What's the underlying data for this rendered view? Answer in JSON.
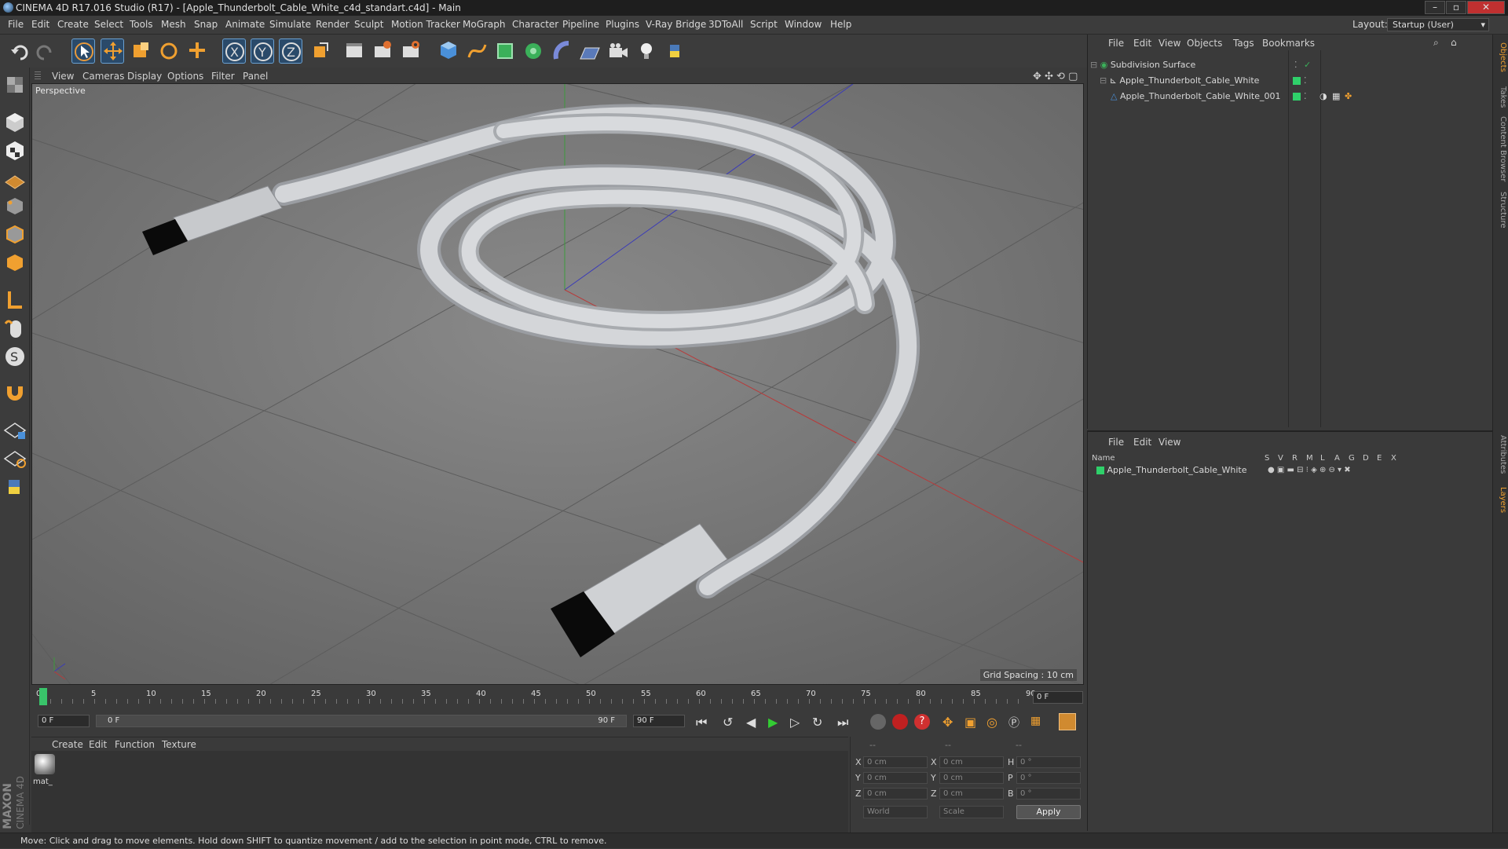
{
  "window": {
    "title": "CINEMA 4D R17.016 Studio (R17) - [Apple_Thunderbolt_Cable_White_c4d_standart.c4d] - Main"
  },
  "menu": [
    "File",
    "Edit",
    "Create",
    "Select",
    "Tools",
    "Mesh",
    "Snap",
    "Animate",
    "Simulate",
    "Render",
    "Sculpt",
    "Motion Tracker",
    "MoGraph",
    "Character",
    "Pipeline",
    "Plugins",
    "V-Ray Bridge",
    "3DToAll",
    "Script",
    "Window",
    "Help"
  ],
  "layout": {
    "label": "Layout:",
    "value": "Startup (User)"
  },
  "viewport": {
    "menu": [
      "View",
      "Cameras",
      "Display",
      "Options",
      "Filter",
      "Panel"
    ],
    "camera_label": "Perspective",
    "grid_spacing": "Grid Spacing : 10 cm"
  },
  "timeline": {
    "ticks": [
      "0",
      "5",
      "10",
      "15",
      "20",
      "25",
      "30",
      "35",
      "40",
      "45",
      "50",
      "55",
      "60",
      "65",
      "70",
      "75",
      "80",
      "85",
      "90"
    ],
    "current_frame": "0 F",
    "start": "0 F",
    "range_start": "0 F",
    "range_end": "90 F",
    "end": "90 F"
  },
  "material_manager": {
    "menu": [
      "Create",
      "Edit",
      "Function",
      "Texture"
    ],
    "material_name": "mat_"
  },
  "coords": {
    "headers": [
      "--",
      "--",
      "--"
    ],
    "rows": [
      {
        "a": "X",
        "av": "0 cm",
        "b": "X",
        "bv": "0 cm",
        "c": "H",
        "cv": "0 °"
      },
      {
        "a": "Y",
        "av": "0 cm",
        "b": "Y",
        "bv": "0 cm",
        "c": "P",
        "cv": "0 °"
      },
      {
        "a": "Z",
        "av": "0 cm",
        "b": "Z",
        "bv": "0 cm",
        "c": "B",
        "cv": "0 °"
      }
    ],
    "mode": "World",
    "size_mode": "Scale",
    "apply_label": "Apply"
  },
  "objects_panel": {
    "menu": [
      "File",
      "Edit",
      "View",
      "Objects",
      "Tags",
      "Bookmarks"
    ],
    "items": [
      {
        "name": "Subdivision Surface"
      },
      {
        "name": "Apple_Thunderbolt_Cable_White"
      },
      {
        "name": "Apple_Thunderbolt_Cable_White_001"
      }
    ]
  },
  "layers_panel": {
    "menu": [
      "File",
      "Edit",
      "View"
    ],
    "col_name": "Name",
    "cols": [
      "S",
      "V",
      "R",
      "M",
      "L",
      "A",
      "G",
      "D",
      "E",
      "X"
    ],
    "items": [
      {
        "name": "Apple_Thunderbolt_Cable_White"
      }
    ]
  },
  "right_tabs": [
    "Objects",
    "Takes",
    "Content Browser",
    "Structure",
    "Attributes",
    "Layers"
  ],
  "status": "Move: Click and drag to move elements. Hold down SHIFT to quantize movement / add to the selection in point mode, CTRL to remove.",
  "brand": {
    "line1": "MAXON",
    "line2": "CINEMA 4D"
  },
  "colors": {
    "accent_blue": "#4a90d9",
    "layer_green": "#2fd06a",
    "viewport_bg": "#7a7a7a"
  }
}
